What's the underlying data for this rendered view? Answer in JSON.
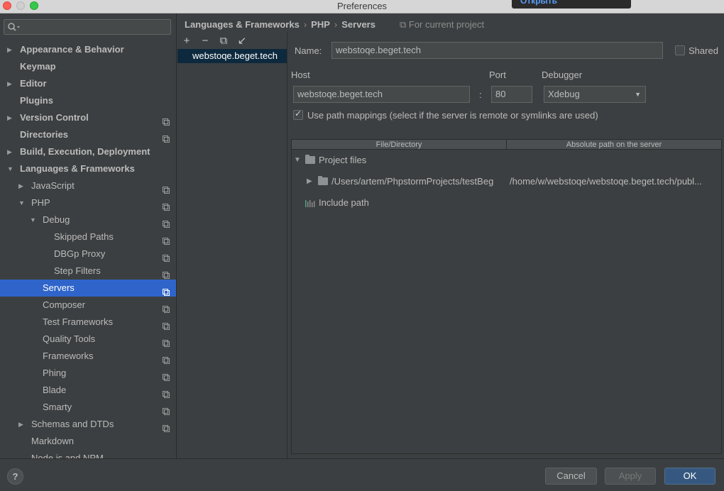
{
  "window": {
    "title": "Preferences",
    "popup_label": "Открыть"
  },
  "search": {
    "placeholder": ""
  },
  "sidebar": {
    "items": [
      {
        "label": "Appearance & Behavior",
        "arrow": "▶"
      },
      {
        "label": "Keymap"
      },
      {
        "label": "Editor",
        "arrow": "▶"
      },
      {
        "label": "Plugins"
      },
      {
        "label": "Version Control",
        "arrow": "▶"
      },
      {
        "label": "Directories"
      },
      {
        "label": "Build, Execution, Deployment",
        "arrow": "▶"
      },
      {
        "label": "Languages & Frameworks",
        "arrow": "▼"
      },
      {
        "label": "JavaScript",
        "arrow": "▶"
      },
      {
        "label": "PHP",
        "arrow": "▼"
      },
      {
        "label": "Debug",
        "arrow": "▼"
      },
      {
        "label": "Skipped Paths"
      },
      {
        "label": "DBGp Proxy"
      },
      {
        "label": "Step Filters"
      },
      {
        "label": "Servers"
      },
      {
        "label": "Composer"
      },
      {
        "label": "Test Frameworks"
      },
      {
        "label": "Quality Tools"
      },
      {
        "label": "Frameworks"
      },
      {
        "label": "Phing"
      },
      {
        "label": "Blade"
      },
      {
        "label": "Smarty"
      },
      {
        "label": "Schemas and DTDs",
        "arrow": "▶"
      },
      {
        "label": "Markdown"
      },
      {
        "label": "Node.js and NPM"
      }
    ]
  },
  "breadcrumb": {
    "items": [
      "Languages & Frameworks",
      "PHP",
      "Servers"
    ],
    "separator": "›",
    "scope": "For current project"
  },
  "servers": {
    "toolbar": {
      "add": "+",
      "remove": "−",
      "copy": "⧉",
      "import": "↙"
    },
    "list": [
      "webstoqe.beget.tech"
    ]
  },
  "form": {
    "name_label": "Name:",
    "name_value": "webstoqe.beget.tech",
    "shared_label": "Shared",
    "host_label": "Host",
    "host_value": "webstoqe.beget.tech",
    "colon": ":",
    "port_label": "Port",
    "port_value": "80",
    "debugger_label": "Debugger",
    "debugger_value": "Xdebug",
    "use_mappings_label": "Use path mappings (select if the server is remote or symlinks are used)"
  },
  "mappings": {
    "col1": "File/Directory",
    "col2": "Absolute path on the server",
    "project_files": "Project files",
    "local_path": "/Users/artem/PhpstormProjects/testBeg",
    "remote_path": "/home/w/webstoqe/webstoqe.beget.tech/publ...",
    "include_path": "Include path"
  },
  "buttons": {
    "help": "?",
    "cancel": "Cancel",
    "apply": "Apply",
    "ok": "OK"
  }
}
